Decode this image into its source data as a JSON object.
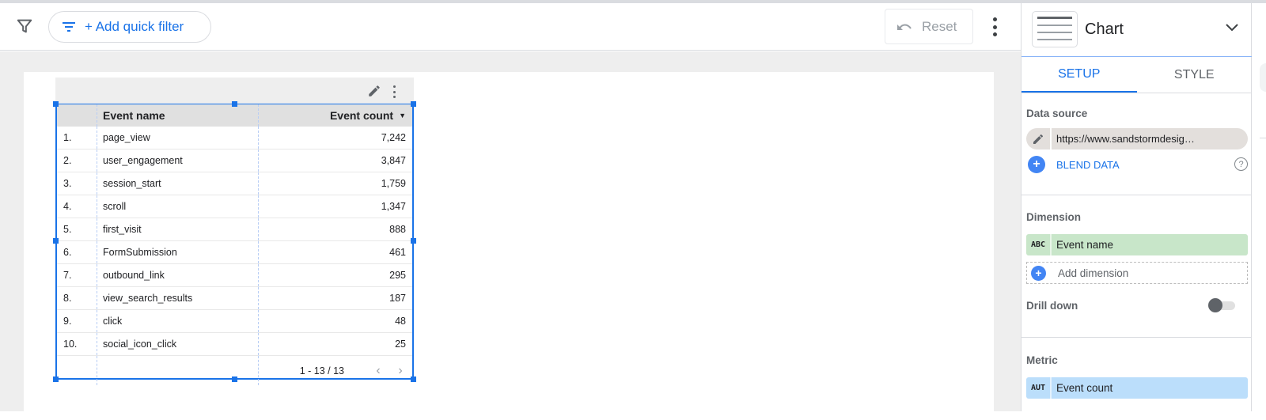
{
  "toolbar": {
    "filter_icon": "filter-funnel-icon",
    "quick_filter_label": "+ Add quick filter",
    "reset_label": "Reset",
    "more_icon": "more-vert-icon"
  },
  "table": {
    "columns": [
      "Event name",
      "Event count"
    ],
    "sort_column": "Event count",
    "sort_direction": "descending",
    "rows": [
      {
        "index": "1.",
        "name": "page_view",
        "count": "7,242"
      },
      {
        "index": "2.",
        "name": "user_engagement",
        "count": "3,847"
      },
      {
        "index": "3.",
        "name": "session_start",
        "count": "1,759"
      },
      {
        "index": "4.",
        "name": "scroll",
        "count": "1,347"
      },
      {
        "index": "5.",
        "name": "first_visit",
        "count": "888"
      },
      {
        "index": "6.",
        "name": "FormSubmission",
        "count": "461"
      },
      {
        "index": "7.",
        "name": "outbound_link",
        "count": "295"
      },
      {
        "index": "8.",
        "name": "view_search_results",
        "count": "187"
      },
      {
        "index": "9.",
        "name": "click",
        "count": "48"
      },
      {
        "index": "10.",
        "name": "social_icon_click",
        "count": "25"
      }
    ],
    "pagination": "1 - 13 / 13"
  },
  "panel": {
    "title": "Chart",
    "tabs": [
      {
        "label": "SETUP",
        "active": true
      },
      {
        "label": "STYLE",
        "active": false
      }
    ],
    "data_source_label": "Data source",
    "data_source_value": "https://www.sandstormdesig…",
    "blend_label": "BLEND DATA",
    "dimension_label": "Dimension",
    "dimension": {
      "type": "ABC",
      "name": "Event name"
    },
    "add_dimension_label": "Add dimension",
    "drill_down_label": "Drill down",
    "drill_down_enabled": false,
    "metric_label": "Metric",
    "metric": {
      "type": "AUT",
      "name": "Event count"
    }
  },
  "colors": {
    "accent": "#1a73e8",
    "dimension_chip": "#c8e6c9",
    "metric_chip": "#bbdefb"
  }
}
